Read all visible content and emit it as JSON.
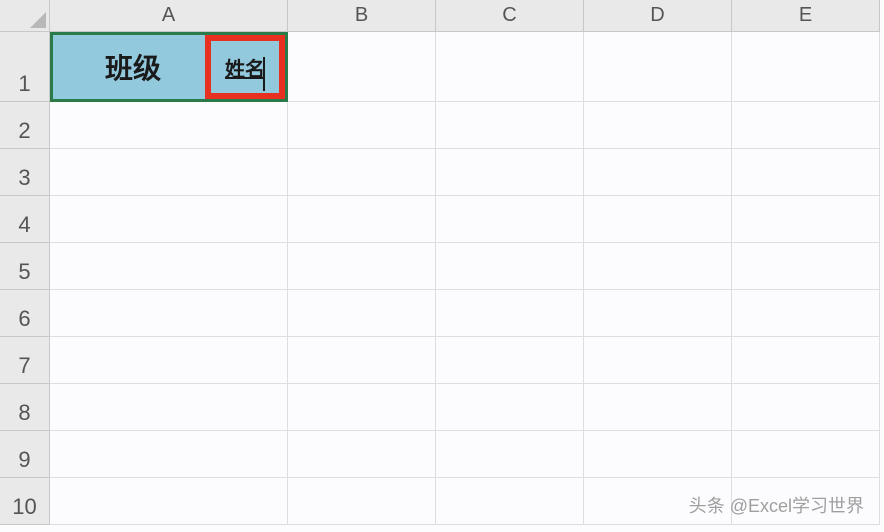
{
  "columns": [
    "A",
    "B",
    "C",
    "D",
    "E"
  ],
  "rows": [
    "1",
    "2",
    "3",
    "4",
    "5",
    "6",
    "7",
    "8",
    "9",
    "10"
  ],
  "a1": {
    "left_text": "班级",
    "right_text": "姓名"
  },
  "watermark": "头条 @Excel学习世界"
}
